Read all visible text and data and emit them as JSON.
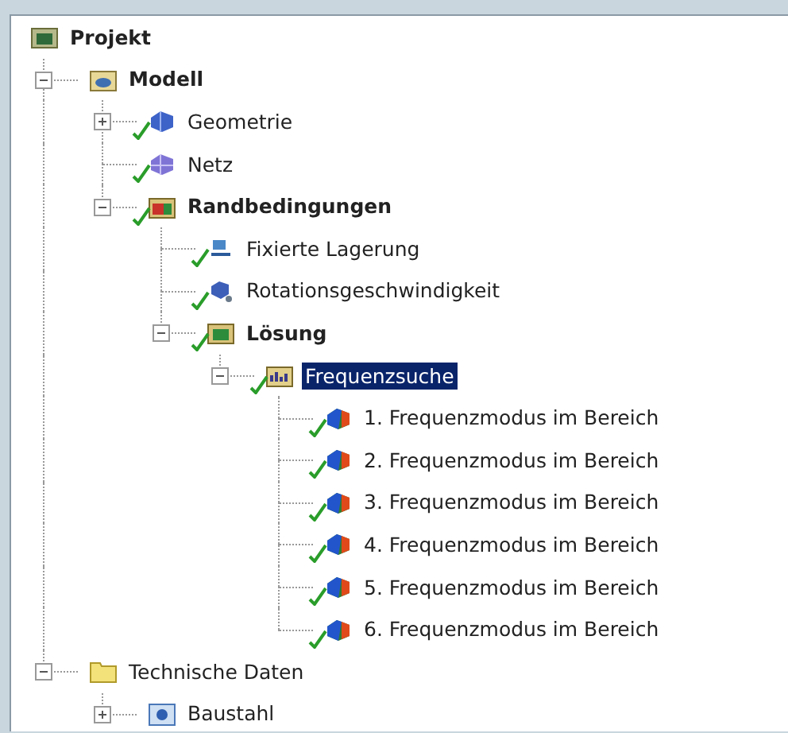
{
  "tree": [
    {
      "label": "Projekt",
      "kind": "project",
      "bold": true,
      "selected": false,
      "children": [
        {
          "label": "Modell",
          "kind": "model",
          "bold": true,
          "selected": false,
          "expanded": true,
          "children": [
            {
              "label": "Geometrie",
              "kind": "geometry",
              "bold": false,
              "selected": false,
              "checked": true,
              "expanded": false
            },
            {
              "label": "Netz",
              "kind": "mesh",
              "bold": false,
              "selected": false,
              "checked": true
            },
            {
              "label": "Randbedingungen",
              "kind": "boundary",
              "bold": true,
              "selected": false,
              "checked": true,
              "expanded": true,
              "children": [
                {
                  "label": "Fixierte Lagerung",
                  "kind": "fixed",
                  "bold": false,
                  "selected": false,
                  "checked": true
                },
                {
                  "label": "Rotationsgeschwindigkeit",
                  "kind": "rotation",
                  "bold": false,
                  "selected": false,
                  "checked": true
                },
                {
                  "label": "Lösung",
                  "kind": "solution",
                  "bold": true,
                  "selected": false,
                  "checked": true,
                  "expanded": true,
                  "children": [
                    {
                      "label": "Frequenzsuche",
                      "kind": "frequency",
                      "bold": false,
                      "selected": true,
                      "checked": true,
                      "expanded": true,
                      "children": [
                        {
                          "label": "1. Frequenzmodus im Bereich",
                          "kind": "mode",
                          "bold": false,
                          "selected": false,
                          "checked": true
                        },
                        {
                          "label": "2. Frequenzmodus im Bereich",
                          "kind": "mode",
                          "bold": false,
                          "selected": false,
                          "checked": true
                        },
                        {
                          "label": "3. Frequenzmodus im Bereich",
                          "kind": "mode",
                          "bold": false,
                          "selected": false,
                          "checked": true
                        },
                        {
                          "label": "4. Frequenzmodus im Bereich",
                          "kind": "mode",
                          "bold": false,
                          "selected": false,
                          "checked": true
                        },
                        {
                          "label": "5. Frequenzmodus im Bereich",
                          "kind": "mode",
                          "bold": false,
                          "selected": false,
                          "checked": true
                        },
                        {
                          "label": "6. Frequenzmodus im Bereich",
                          "kind": "mode",
                          "bold": false,
                          "selected": false,
                          "checked": true
                        }
                      ]
                    }
                  ]
                }
              ]
            }
          ]
        },
        {
          "label": "Technische Daten",
          "kind": "folder",
          "bold": false,
          "selected": false,
          "expanded": true,
          "children": [
            {
              "label": "Baustahl",
              "kind": "material",
              "bold": false,
              "selected": false,
              "expanded": false
            }
          ]
        }
      ]
    }
  ]
}
